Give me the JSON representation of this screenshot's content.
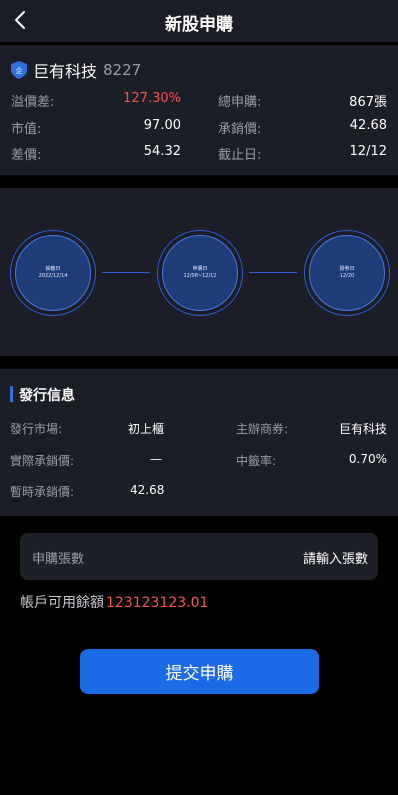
{
  "header": {
    "title": "新股申購",
    "back_icon": "chevron-left-icon"
  },
  "stock": {
    "name": "巨有科技",
    "code": "8227",
    "icon": "shield-icon",
    "fields": [
      {
        "label": "溢價差:",
        "value": "127.30%",
        "highlight": true
      },
      {
        "label": "總申購:",
        "value": "867張",
        "highlight": false
      },
      {
        "label": "市值:",
        "value": "97.00",
        "highlight": false
      },
      {
        "label": "承銷價:",
        "value": "42.68",
        "highlight": false
      },
      {
        "label": "差價:",
        "value": "54.32",
        "highlight": false
      },
      {
        "label": "截止日:",
        "value": "12/12",
        "highlight": false
      }
    ]
  },
  "timeline": [
    {
      "label": "抽籤日",
      "date": "2022/12/14"
    },
    {
      "label": "申購日",
      "date": "12/08~12/12"
    },
    {
      "label": "撥券日",
      "date": "12/20"
    }
  ],
  "issue": {
    "title": "發行信息",
    "fields": [
      {
        "label": "發行市場:",
        "value": "初上櫃"
      },
      {
        "label": "主辦商券:",
        "value": "巨有科技"
      },
      {
        "label": "實際承銷價:",
        "value": "—"
      },
      {
        "label": "中籤率:",
        "value": "0.70%"
      },
      {
        "label": "暫時承銷價:",
        "value": "42.68"
      }
    ]
  },
  "form": {
    "input_label": "申購張數",
    "input_placeholder": "請輸入張數",
    "balance_label": "帳戶可用餘額",
    "balance_value": "123123123.01",
    "submit_label": "提交申購"
  },
  "colors": {
    "accent": "#1c6be6",
    "highlight": "#f5534d",
    "card": "#1b1d27"
  }
}
